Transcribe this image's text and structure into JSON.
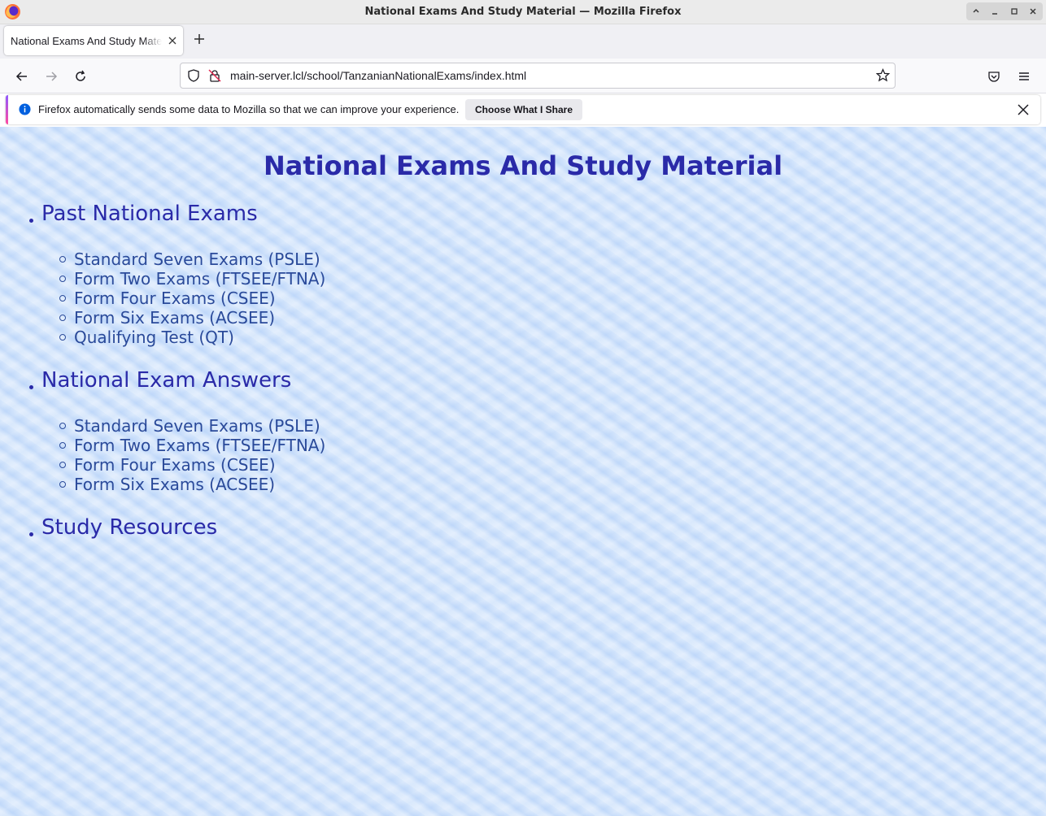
{
  "window": {
    "title": "National Exams And Study Material — Mozilla Firefox"
  },
  "tabs": [
    {
      "label": "National Exams And Study Material"
    }
  ],
  "navbar": {
    "url": "main-server.lcl/school/TanzanianNationalExams/index.html"
  },
  "notification": {
    "message": "Firefox automatically sends some data to Mozilla so that we can improve your experience.",
    "button_label": "Choose What I Share"
  },
  "page": {
    "title": "National Exams And Study Material",
    "sections": [
      {
        "heading": "Past National Exams",
        "items": [
          "Standard Seven Exams (PSLE)",
          "Form Two Exams (FTSEE/FTNA)",
          "Form Four Exams (CSEE)",
          "Form Six Exams (ACSEE)",
          "Qualifying Test (QT)"
        ]
      },
      {
        "heading": "National Exam Answers",
        "items": [
          "Standard Seven Exams (PSLE)",
          "Form Two Exams (FTSEE/FTNA)",
          "Form Four Exams (CSEE)",
          "Form Six Exams (ACSEE)"
        ]
      },
      {
        "heading": "Study Resources",
        "items": []
      }
    ]
  },
  "colors": {
    "heading": "#2a2aa8",
    "link": "#2a4a9a",
    "background": "#c4dcfb"
  }
}
